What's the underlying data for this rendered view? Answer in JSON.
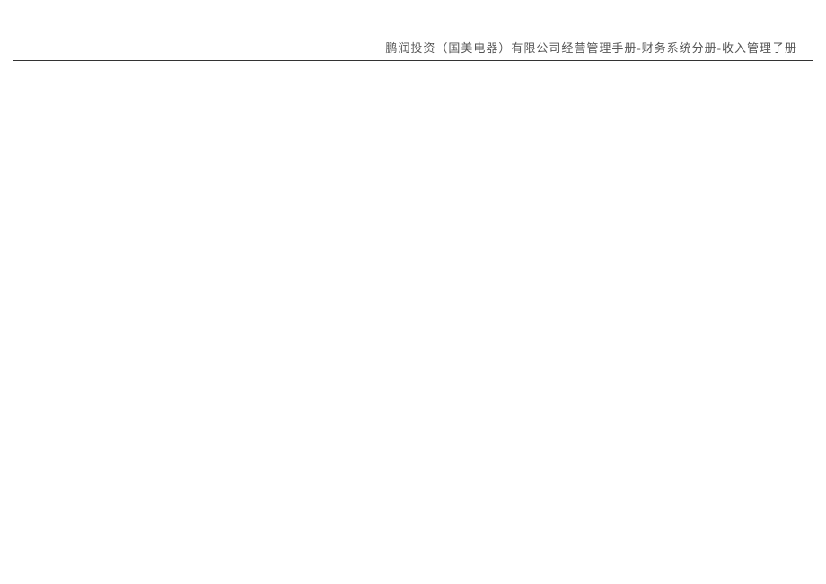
{
  "header": {
    "text": "鹏润投资（国美电器）有限公司经营管理手册-财务系统分册-收入管理子册"
  }
}
